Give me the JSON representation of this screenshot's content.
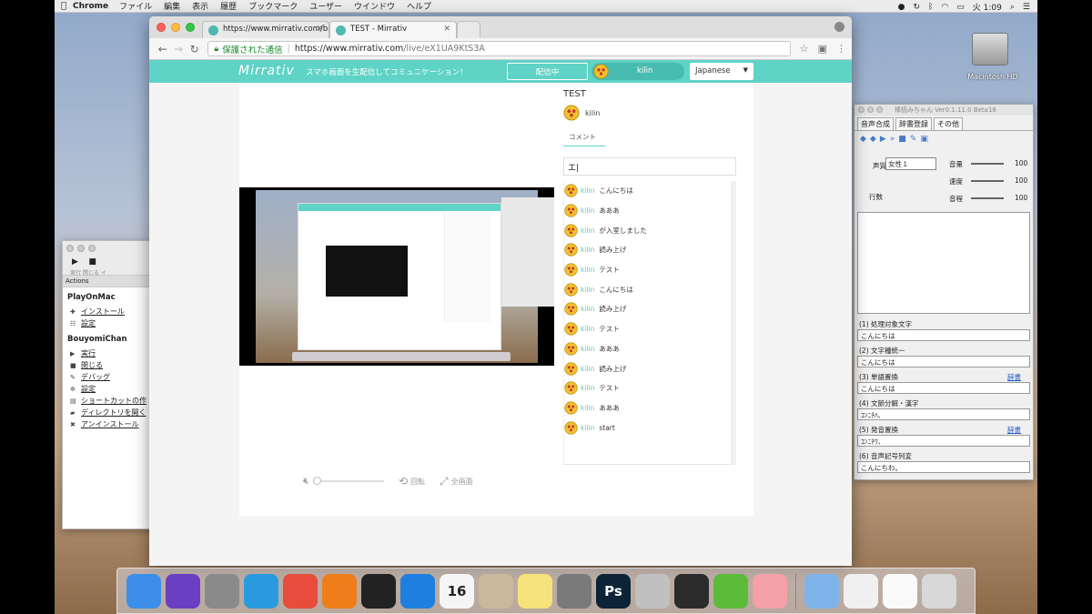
{
  "menubar": {
    "app_name": "Chrome",
    "menus": [
      "ファイル",
      "編集",
      "表示",
      "履歴",
      "ブックマーク",
      "ユーザー",
      "ウインドウ",
      "ヘルプ"
    ],
    "clock": "火 1:09"
  },
  "desktop": {
    "hd_label": "Macintosh HD"
  },
  "browser": {
    "tabs": [
      {
        "title": "https://www.mirrativ.com/broa"
      },
      {
        "title": "TEST - Mirrativ"
      }
    ],
    "secure_label": "保護された通信",
    "url_host": "https://www.mirrativ.com",
    "url_path": "/live/eX1UA9KtS3A"
  },
  "site": {
    "logo": "Mirrativ",
    "tagline": "スマホ画面を生配信してコミュニケーション！",
    "live_button": "配信中",
    "user_name": "kilin",
    "language": "Japanese"
  },
  "stream": {
    "title": "TEST",
    "streamer": "kilin",
    "comment_tab": "コメント",
    "comment_input": "エ|",
    "comments": [
      {
        "name": "kilin",
        "text": "こんにちは"
      },
      {
        "name": "kilin",
        "text": "あああ"
      },
      {
        "name": "kilin",
        "text": "が入室しました"
      },
      {
        "name": "kilin",
        "text": "読み上げ"
      },
      {
        "name": "kilin",
        "text": "テスト"
      },
      {
        "name": "kilin",
        "text": "こんにちは"
      },
      {
        "name": "kilin",
        "text": "読み上げ"
      },
      {
        "name": "kilin",
        "text": "テスト"
      },
      {
        "name": "kilin",
        "text": "あああ"
      },
      {
        "name": "kilin",
        "text": "読み上げ"
      },
      {
        "name": "kilin",
        "text": "テスト"
      },
      {
        "name": "kilin",
        "text": "あああ"
      },
      {
        "name": "kilin",
        "text": "start"
      }
    ],
    "controls": {
      "rotate": "回転",
      "fullscreen": "全画面"
    }
  },
  "actions_panel": {
    "toolbar_labels": "実行  閉じる    イ",
    "header": "Actions",
    "groups": [
      {
        "name": "PlayOnMac",
        "items": [
          "インストール",
          "設定"
        ]
      },
      {
        "name": "BouyomiChan",
        "items": [
          "実行",
          "閉じる",
          "デバッグ",
          "設定",
          "ショートカットの作",
          "ディレクトリを開く",
          "アンインストール"
        ]
      }
    ]
  },
  "bouyomi": {
    "title": "棒読みちゃん Ver0.1.11.0 Beta16",
    "tabs": [
      "音声合成",
      "辞書登録",
      "その他"
    ],
    "voice_label": "声質",
    "voice_value": "女性１",
    "volume_label": "音量",
    "volume_value": "100",
    "speed_label": "速度",
    "speed_value": "100",
    "pitch_label": "音程",
    "pitch_value": "100",
    "line_label": "行数",
    "stages": [
      {
        "label": "(1) 処理対象文字",
        "value": "こんにちは",
        "dict": ""
      },
      {
        "label": "(2) 文字種統一",
        "value": "こんにちは",
        "dict": ""
      },
      {
        "label": "(3) 単語置換",
        "value": "こんにちは",
        "dict": "辞書"
      },
      {
        "label": "(4) 文節分解・漢字",
        "value": "ｺﾝﾆﾁﾊ、",
        "dict": ""
      },
      {
        "label": "(5) 発音置換",
        "value": "ｺﾝﾆﾁﾜ、",
        "dict": "辞書"
      },
      {
        "label": "(6) 音声記号列変",
        "value": "こんにちわ。",
        "dict": ""
      }
    ]
  },
  "dock": {
    "apps": [
      {
        "icon": "finder-icon",
        "color": "#3d8ee8"
      },
      {
        "icon": "siri-icon",
        "color": "#6a3fc2"
      },
      {
        "icon": "launchpad-icon",
        "color": "#8a8a8a"
      },
      {
        "icon": "safari-icon",
        "color": "#2a9ae0"
      },
      {
        "icon": "chrome-icon",
        "color": "#e74c3c"
      },
      {
        "icon": "firefox-icon",
        "color": "#ef7d1a"
      },
      {
        "icon": "terminal-icon",
        "color": "#222222"
      },
      {
        "icon": "screen-sharing-icon",
        "color": "#1e7fe0"
      },
      {
        "icon": "calendar-icon",
        "color": "#f5f5f5",
        "text": "16"
      },
      {
        "icon": "preview-icon",
        "color": "#c9b99a"
      },
      {
        "icon": "notes-icon",
        "color": "#f5e27a"
      },
      {
        "icon": "system-preferences-icon",
        "color": "#7a7a7a"
      },
      {
        "icon": "photoshop-icon",
        "color": "#0c2338",
        "text": "Ps"
      },
      {
        "icon": "sourcetree-icon",
        "color": "#c0c0c0"
      },
      {
        "icon": "obs-icon",
        "color": "#2b2b2b"
      },
      {
        "icon": "playonmac-icon",
        "color": "#5dbb3a"
      },
      {
        "icon": "mirrativ-lips-icon",
        "color": "#f3a0a8"
      },
      {
        "icon": "folder-icon",
        "color": "#7fb4ea"
      },
      {
        "icon": "window-preview-icon",
        "color": "#f0f0f0"
      },
      {
        "icon": "document-icon",
        "color": "#fafafa"
      },
      {
        "icon": "trash-icon",
        "color": "#d8d8d8"
      }
    ]
  }
}
